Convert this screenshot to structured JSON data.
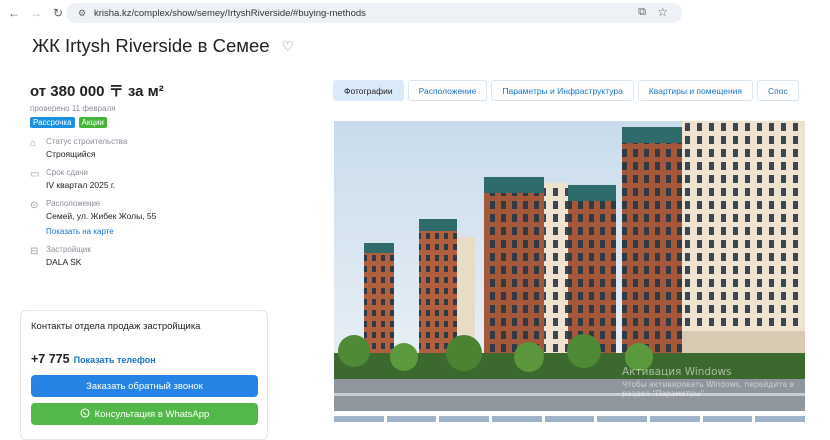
{
  "browser": {
    "url": "krisha.kz/complex/show/semey/IrtyshRiverside/#buying-methods"
  },
  "title": "ЖК Irtysh Riverside в Семее",
  "price": {
    "text": "от 380 000 〒 за м²",
    "checked": "проверено 11 февраля"
  },
  "badges": [
    "Рассрочка",
    "Акции"
  ],
  "info": {
    "status_label": "Статус строительства",
    "status_value": "Строящийся",
    "deadline_label": "Срок сдачи",
    "deadline_value": "IV квартал 2025 г.",
    "location_label": "Расположение",
    "location_value": "Семей, ул. Жибек Жолы, 55",
    "map_link": "Показать на карте",
    "developer_label": "Застройщик",
    "developer_value": "DALA SK"
  },
  "contact": {
    "title": "Контакты отдела продаж застройщика",
    "phone": "+7 775",
    "show_phone": "Показать телефон",
    "callback": "Заказать обратный звонок",
    "whatsapp": "Консультация в WhatsApp"
  },
  "tabs": [
    "Фотографии",
    "Расположение",
    "Параметры и Инфраструктура",
    "Квартиры и помещения",
    "Спос"
  ],
  "watermark": {
    "line1": "Активация Windows",
    "line2": "Чтобы активировать Windows, перейдите в",
    "line3": "раздел \"Параметры\"."
  }
}
